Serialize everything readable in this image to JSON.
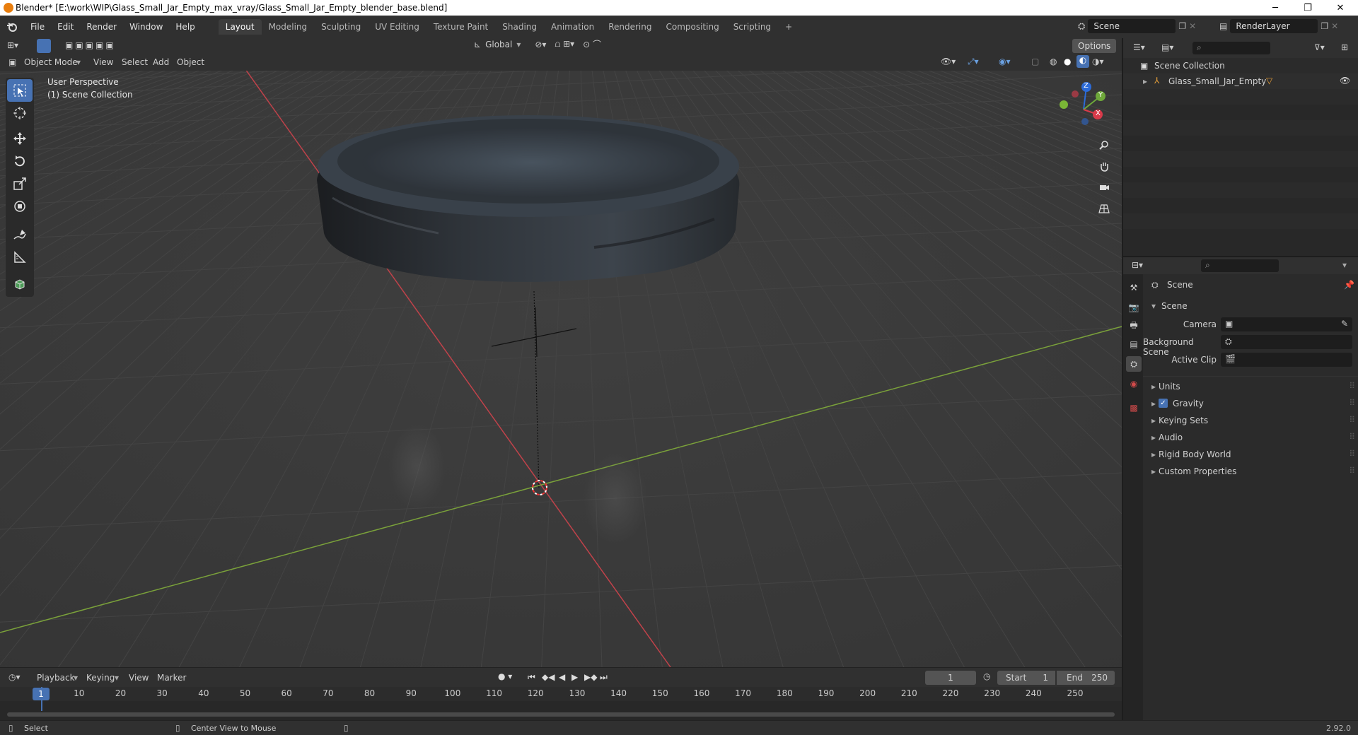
{
  "window": {
    "title": "Blender* [E:\\work\\WIP\\Glass_Small_Jar_Empty_max_vray/Glass_Small_Jar_Empty_blender_base.blend]",
    "minimize": "─",
    "maximize": "❐",
    "close": "✕"
  },
  "menu": [
    "File",
    "Edit",
    "Render",
    "Window",
    "Help"
  ],
  "workspaces": [
    "Layout",
    "Modeling",
    "Sculpting",
    "UV Editing",
    "Texture Paint",
    "Shading",
    "Animation",
    "Rendering",
    "Compositing",
    "Scripting"
  ],
  "active_workspace": "Layout",
  "add_workspace": "+",
  "scene_name": "Scene",
  "view_layer": "RenderLayer",
  "viewport": {
    "mode": "Object Mode",
    "menus": [
      "View",
      "Select",
      "Add",
      "Object"
    ],
    "transform_orientation": "Global",
    "options": "Options",
    "overlay_line1": "User Perspective",
    "overlay_line2": "(1) Scene Collection",
    "gizmo": {
      "x": "X",
      "y": "Y",
      "z": "Z"
    },
    "colors": {
      "x_axis": "#c0424a",
      "y_axis": "#7aa13a",
      "background": "#3a3a3a",
      "grid": "#444444"
    }
  },
  "outliner": {
    "root": "Scene Collection",
    "items": [
      {
        "name": "Glass_Small_Jar_Empty"
      }
    ]
  },
  "properties": {
    "context": "Scene",
    "section": "Scene",
    "fields": [
      {
        "label": "Camera",
        "value": ""
      },
      {
        "label": "Background Scene",
        "value": ""
      },
      {
        "label": "Active Clip",
        "value": ""
      }
    ],
    "panels": [
      "Units",
      "Gravity",
      "Keying Sets",
      "Audio",
      "Rigid Body World",
      "Custom Properties"
    ],
    "gravity_checked": true
  },
  "timeline": {
    "menus": [
      "Playback",
      "Keying",
      "View",
      "Marker"
    ],
    "current_frame": "1",
    "start_label": "Start",
    "start": "1",
    "end_label": "End",
    "end": "250",
    "ticks": [
      "1",
      "10",
      "20",
      "30",
      "40",
      "50",
      "60",
      "70",
      "80",
      "90",
      "100",
      "110",
      "120",
      "130",
      "140",
      "150",
      "160",
      "170",
      "180",
      "190",
      "200",
      "210",
      "220",
      "230",
      "240",
      "250"
    ],
    "playhead_color": "#4772b3"
  },
  "statusbar": {
    "left": "Select",
    "middle": "Center View to Mouse",
    "version": "2.92.0"
  }
}
